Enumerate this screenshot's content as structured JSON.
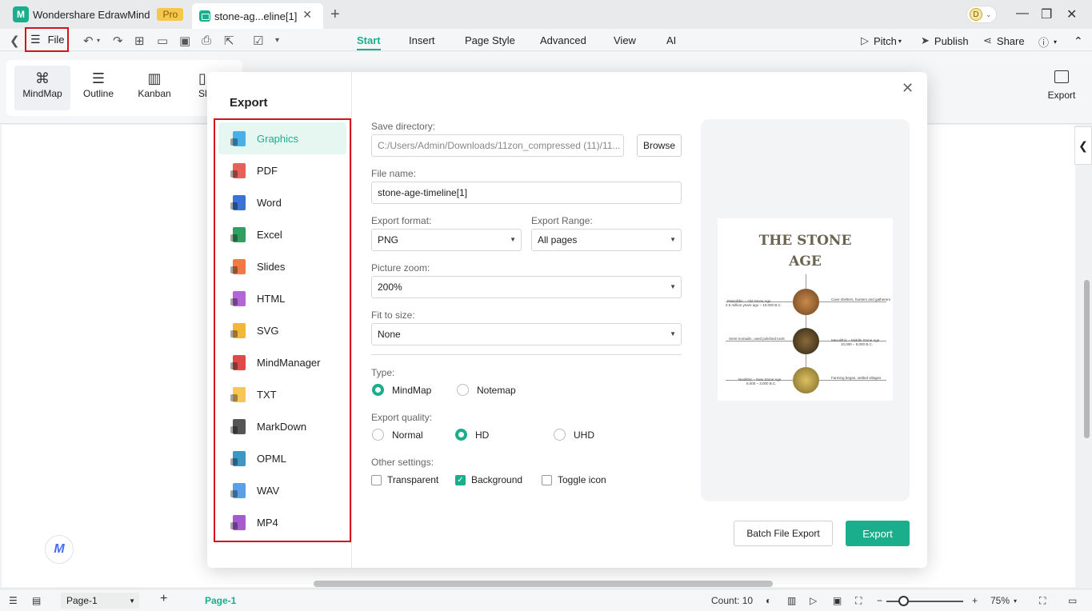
{
  "titlebar": {
    "app_name": "Wondershare EdrawMind",
    "pro_badge": "Pro",
    "doc_tab": "stone-ag...eline[1]",
    "avatar_letter": "D"
  },
  "menubar": {
    "file_label": "File",
    "tabs": [
      "Start",
      "Insert",
      "Page Style",
      "Advanced",
      "View",
      "AI"
    ],
    "active_tab": "Start",
    "right": {
      "pitch": "Pitch",
      "publish": "Publish",
      "share": "Share"
    }
  },
  "toolbar": {
    "views": [
      {
        "label": "MindMap",
        "icon": "mindmap-icon"
      },
      {
        "label": "Outline",
        "icon": "outline-icon"
      },
      {
        "label": "Kanban",
        "icon": "kanban-icon"
      },
      {
        "label": "Sli",
        "icon": "slides-icon"
      }
    ],
    "export_label": "Export"
  },
  "dialog": {
    "title": "Export",
    "formats": [
      {
        "label": "Graphics",
        "color": "#48b0e8",
        "selected": true
      },
      {
        "label": "PDF",
        "color": "#e8605a"
      },
      {
        "label": "Word",
        "color": "#3a72d6"
      },
      {
        "label": "Excel",
        "color": "#2fa05f"
      },
      {
        "label": "Slides",
        "color": "#f07a42"
      },
      {
        "label": "HTML",
        "color": "#b266d8"
      },
      {
        "label": "SVG",
        "color": "#f2b638"
      },
      {
        "label": "MindManager",
        "color": "#de4a4a"
      },
      {
        "label": "TXT",
        "color": "#f6c656"
      },
      {
        "label": "MarkDown",
        "color": "#555555"
      },
      {
        "label": "OPML",
        "color": "#3b97c4"
      },
      {
        "label": "WAV",
        "color": "#5aa0e8"
      },
      {
        "label": "MP4",
        "color": "#a55bd0"
      }
    ],
    "save_directory_label": "Save directory:",
    "save_directory_value": "C:/Users/Admin/Downloads/11zon_compressed (11)/11...",
    "browse_label": "Browse",
    "file_name_label": "File name:",
    "file_name_value": "stone-age-timeline[1]",
    "export_format_label": "Export format:",
    "export_format_value": "PNG",
    "export_range_label": "Export Range:",
    "export_range_value": "All pages",
    "picture_zoom_label": "Picture zoom:",
    "picture_zoom_value": "200%",
    "fit_to_size_label": "Fit to size:",
    "fit_to_size_value": "None",
    "type_label": "Type:",
    "type_options": [
      "MindMap",
      "Notemap"
    ],
    "type_selected": "MindMap",
    "quality_label": "Export quality:",
    "quality_options": [
      "Normal",
      "HD",
      "UHD"
    ],
    "quality_selected": "HD",
    "other_label": "Other settings:",
    "other_options": [
      {
        "label": "Transparent",
        "checked": false
      },
      {
        "label": "Background",
        "checked": true
      },
      {
        "label": "Toggle icon",
        "checked": false
      }
    ],
    "batch_label": "Batch File Export",
    "export_label": "Export",
    "preview": {
      "title_line1": "THE STONE",
      "title_line2": "AGE",
      "left1": "Paleolithic – Old Stone Age",
      "left1b": "2.5 million years ago – 10,000 B.C.",
      "right1": "Cave shelters, hunters and gatherers",
      "left2": "Semi-nomadic, used polished tools",
      "right2": "Mesolithic – Middle Stone Age",
      "right2b": "10,000 – 8,000 B.C.",
      "left3": "Neolithic – New Stone Age",
      "left3b": "8,000 – 3,000 B.C.",
      "right3": "Farming began, settled villages"
    }
  },
  "statusbar": {
    "page_select": "Page-1",
    "page_tab": "Page-1",
    "count": "Count: 10",
    "zoom": "75%"
  },
  "colors": {
    "accent": "#1bae8c",
    "highlight": "#d4141c"
  }
}
